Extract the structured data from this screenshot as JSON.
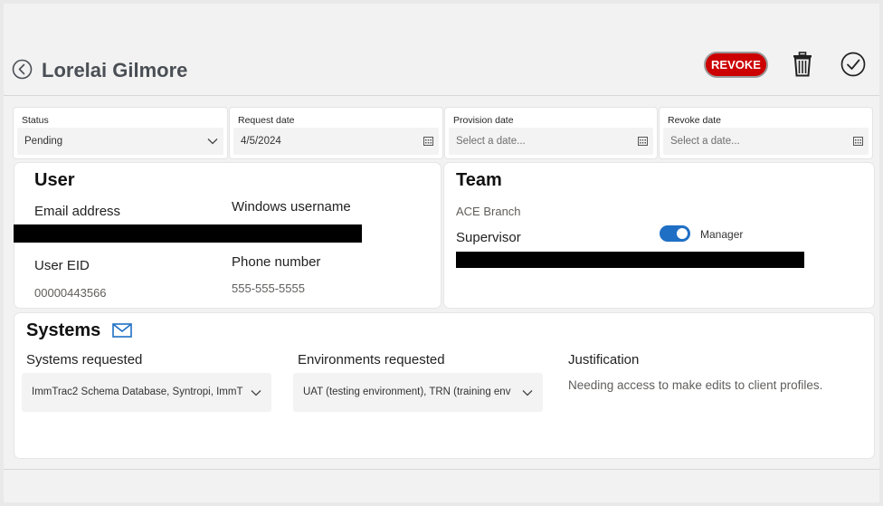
{
  "header": {
    "title": "Lorelai Gilmore",
    "revoke_label": "REVOKE"
  },
  "dates": {
    "status": {
      "label": "Status",
      "value": "Pending"
    },
    "request_date": {
      "label": "Request date",
      "value": "4/5/2024"
    },
    "provision_date": {
      "label": "Provision date",
      "placeholder": "Select a date..."
    },
    "revoke_date": {
      "label": "Revoke date",
      "placeholder": "Select a date..."
    }
  },
  "user": {
    "title": "User",
    "email_label": "Email address",
    "windows_label": "Windows username",
    "eid_label": "User EID",
    "eid_value": "00000443566",
    "phone_label": "Phone number",
    "phone_value": "555-555-5555"
  },
  "team": {
    "title": "Team",
    "branch": "ACE Branch",
    "supervisor_label": "Supervisor",
    "manager_label": "Manager",
    "manager_on": true
  },
  "systems": {
    "title": "Systems",
    "systems_label": "Systems requested",
    "systems_value": "ImmTrac2 Schema Database, Syntropi, ImmT",
    "environments_label": "Environments requested",
    "environments_value": "UAT (testing environment), TRN (training env",
    "justification_label": "Justification",
    "justification_value": "Needing access to make edits to client profiles."
  },
  "colors": {
    "revoke": "#cc0000",
    "toggle": "#1f6fc5",
    "title": "#4a4f55"
  },
  "icons": {
    "back": "back-arrow-circle-icon",
    "delete": "trash-icon",
    "approve": "checkmark-circle-icon",
    "calendar": "calendar-icon",
    "dropdown": "chevron-down-icon",
    "mail": "mail-icon"
  }
}
